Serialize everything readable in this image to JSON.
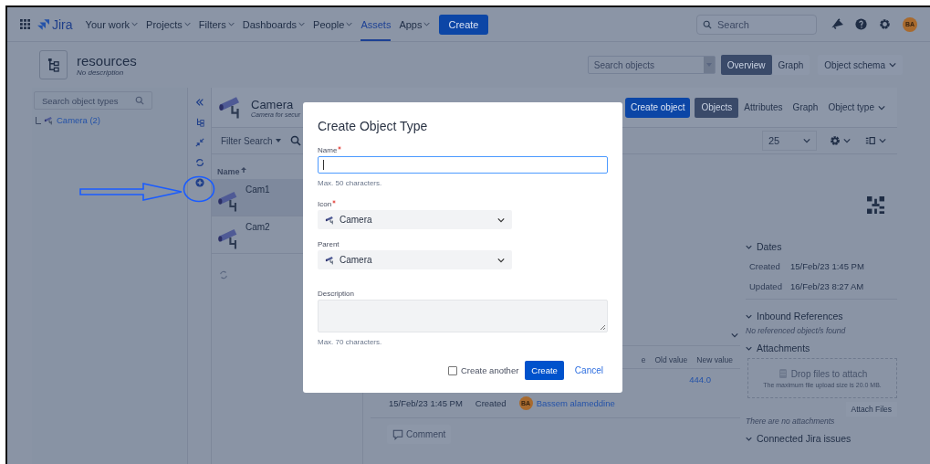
{
  "nav": {
    "logo": "Jira",
    "items": [
      {
        "label": "Your work",
        "dropdown": true,
        "selected": false
      },
      {
        "label": "Projects",
        "dropdown": true,
        "selected": false
      },
      {
        "label": "Filters",
        "dropdown": true,
        "selected": false
      },
      {
        "label": "Dashboards",
        "dropdown": true,
        "selected": false
      },
      {
        "label": "People",
        "dropdown": true,
        "selected": false
      },
      {
        "label": "Assets",
        "dropdown": false,
        "selected": true
      },
      {
        "label": "Apps",
        "dropdown": true,
        "selected": false
      }
    ],
    "create": "Create",
    "search_placeholder": "Search",
    "avatar": "BA"
  },
  "schema": {
    "title": "resources",
    "description": "No description",
    "search_placeholder": "Search objects",
    "tabs": [
      {
        "label": "Overview",
        "selected": true
      },
      {
        "label": "Graph",
        "selected": false
      }
    ],
    "menu": "Object schema"
  },
  "tree": {
    "search_placeholder": "Search object types",
    "items": [
      {
        "label": "Camera (2)",
        "selected": false
      }
    ]
  },
  "object_type": {
    "title": "Camera",
    "description": "Camera for secur",
    "create": "Create object",
    "tabs": [
      {
        "label": "Objects",
        "selected": true
      },
      {
        "label": "Attributes",
        "selected": false
      },
      {
        "label": "Graph",
        "selected": false
      }
    ],
    "menu": "Object type",
    "filter": "Filter Search",
    "page_size": "25",
    "column": "Name",
    "objects": [
      {
        "name": "Cam1",
        "selected": true
      },
      {
        "name": "Cam2",
        "selected": false
      }
    ]
  },
  "history": {
    "columns": [
      "e",
      "Old value",
      "New value"
    ],
    "changed_value": "444.0",
    "entries": [
      {
        "date": "15/Feb/23 1:45 PM",
        "action": "Created",
        "avatar": "BA",
        "user": "Bassem alameddine"
      }
    ],
    "comment": "Comment"
  },
  "details": {
    "sections": [
      {
        "kind": "dates",
        "title": "Dates",
        "expanded": true,
        "rows": [
          {
            "label": "Created",
            "value": "15/Feb/23 1:45 PM"
          },
          {
            "label": "Updated",
            "value": "16/Feb/23 8:27 AM"
          }
        ]
      },
      {
        "kind": "note",
        "title": "Inbound References",
        "expanded": true,
        "note": "No referenced object/s found"
      },
      {
        "kind": "attachments",
        "title": "Attachments",
        "expanded": true,
        "drop_title": "Drop files to attach",
        "drop_hint": "The maximum file upload size is 20.0 MB.",
        "button": "Attach Files",
        "note": "There are no attachments"
      },
      {
        "kind": "header",
        "title": "Connected Jira issues",
        "expanded": true
      }
    ]
  },
  "dialog": {
    "title": "Create Object Type",
    "fields": [
      {
        "kind": "text",
        "label": "Name",
        "required": true,
        "focused": true,
        "hint": "Max. 50 characters."
      },
      {
        "kind": "select",
        "label": "Icon",
        "required": true,
        "value": "Camera"
      },
      {
        "kind": "select",
        "label": "Parent",
        "required": false,
        "value": "Camera"
      },
      {
        "kind": "textarea",
        "label": "Description",
        "required": false,
        "hint": "Max. 70 characters."
      }
    ],
    "create_another": {
      "label": "Create another",
      "checked": false
    },
    "submit": "Create",
    "cancel": "Cancel"
  }
}
